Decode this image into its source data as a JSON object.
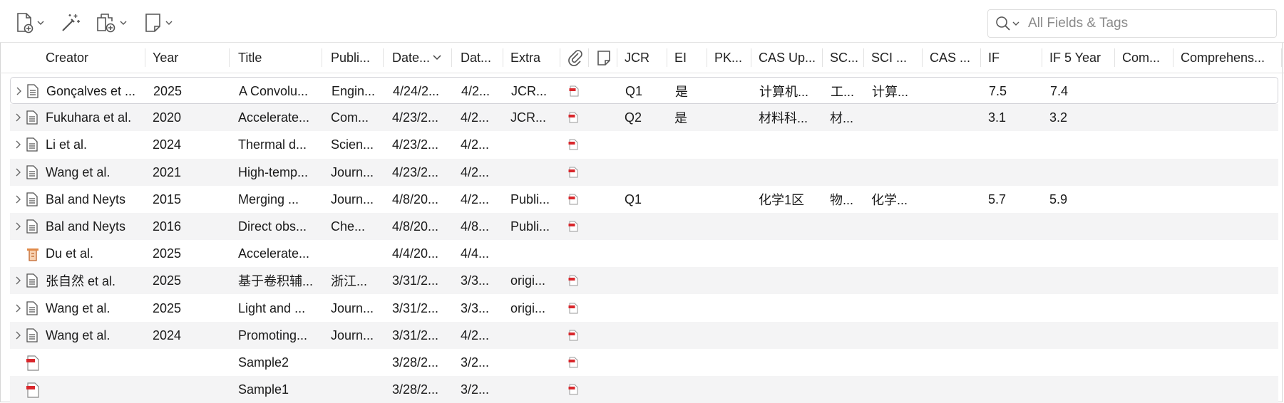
{
  "toolbar": {
    "new_item_icon": "new-item-icon",
    "magic_wand_icon": "add-by-identifier-icon",
    "new_attachment_icon": "new-attachment-icon",
    "new_note_icon": "new-note-icon",
    "search_placeholder": "All Fields & Tags"
  },
  "columns": [
    {
      "key": "creator",
      "label": "Creator"
    },
    {
      "key": "year",
      "label": "Year"
    },
    {
      "key": "title",
      "label": "Title"
    },
    {
      "key": "publication",
      "label": "Publi..."
    },
    {
      "key": "date_added",
      "label": "Date..."
    },
    {
      "key": "date_modified",
      "label": "Dat..."
    },
    {
      "key": "extra",
      "label": "Extra"
    },
    {
      "key": "attachments",
      "label": ""
    },
    {
      "key": "notes",
      "label": ""
    },
    {
      "key": "jcr",
      "label": "JCR"
    },
    {
      "key": "ei",
      "label": "EI"
    },
    {
      "key": "pku",
      "label": "PK..."
    },
    {
      "key": "cas_up",
      "label": "CAS Up..."
    },
    {
      "key": "sc",
      "label": "SC..."
    },
    {
      "key": "sci",
      "label": "SCI ..."
    },
    {
      "key": "cas",
      "label": "CAS ..."
    },
    {
      "key": "if",
      "label": "IF"
    },
    {
      "key": "if5",
      "label": "IF 5 Year"
    },
    {
      "key": "com",
      "label": "Com..."
    },
    {
      "key": "comprehensive",
      "label": "Comprehens..."
    }
  ],
  "rows": [
    {
      "expandable": true,
      "type": "journal",
      "creator": "Gonçalves et ...",
      "year": "2025",
      "title": "A Convolu...",
      "publication": "Engin...",
      "date_added": "4/24/2...",
      "date_modified": "4/2...",
      "extra": "JCR...",
      "pdf": true,
      "jcr": "Q1",
      "ei": "是",
      "pku": "",
      "cas_up": "计算机...",
      "sc": "工...",
      "sci": "计算...",
      "cas": "",
      "if": "7.5",
      "if5": "7.4"
    },
    {
      "expandable": true,
      "type": "journal",
      "creator": "Fukuhara et al.",
      "year": "2020",
      "title": "Accelerate...",
      "publication": "Com...",
      "date_added": "4/23/2...",
      "date_modified": "4/2...",
      "extra": "JCR...",
      "pdf": true,
      "jcr": "Q2",
      "ei": "是",
      "pku": "",
      "cas_up": "材料科...",
      "sc": "材...",
      "sci": "",
      "cas": "",
      "if": "3.1",
      "if5": "3.2"
    },
    {
      "expandable": true,
      "type": "journal",
      "creator": "Li et al.",
      "year": "2024",
      "title": "Thermal d...",
      "publication": "Scien...",
      "date_added": "4/23/2...",
      "date_modified": "4/2...",
      "extra": "",
      "pdf": true,
      "jcr": "",
      "ei": "",
      "pku": "",
      "cas_up": "",
      "sc": "",
      "sci": "",
      "cas": "",
      "if": "",
      "if5": ""
    },
    {
      "expandable": true,
      "type": "journal",
      "creator": "Wang et al.",
      "year": "2021",
      "title": "High-temp...",
      "publication": "Journ...",
      "date_added": "4/23/2...",
      "date_modified": "4/2...",
      "extra": "",
      "pdf": true,
      "jcr": "",
      "ei": "",
      "pku": "",
      "cas_up": "",
      "sc": "",
      "sci": "",
      "cas": "",
      "if": "",
      "if5": ""
    },
    {
      "expandable": true,
      "type": "journal",
      "creator": "Bal and Neyts",
      "year": "2015",
      "title": "Merging ...",
      "publication": "Journ...",
      "date_added": "4/8/20...",
      "date_modified": "4/2...",
      "extra": "Publi...",
      "pdf": true,
      "jcr": "Q1",
      "ei": "",
      "pku": "",
      "cas_up": "化学1区",
      "sc": "物...",
      "sci": "化学...",
      "cas": "",
      "if": "5.7",
      "if5": "5.9"
    },
    {
      "expandable": true,
      "type": "journal",
      "creator": "Bal and Neyts",
      "year": "2016",
      "title": "Direct obs...",
      "publication": "Che...",
      "date_added": "4/8/20...",
      "date_modified": "4/8...",
      "extra": "Publi...",
      "pdf": true,
      "jcr": "",
      "ei": "",
      "pku": "",
      "cas_up": "",
      "sc": "",
      "sci": "",
      "cas": "",
      "if": "",
      "if5": ""
    },
    {
      "expandable": false,
      "type": "preprint",
      "creator": "Du et al.",
      "year": "2025",
      "title": "Accelerate...",
      "publication": "",
      "date_added": "4/4/20...",
      "date_modified": "4/4...",
      "extra": "",
      "pdf": false,
      "jcr": "",
      "ei": "",
      "pku": "",
      "cas_up": "",
      "sc": "",
      "sci": "",
      "cas": "",
      "if": "",
      "if5": ""
    },
    {
      "expandable": true,
      "type": "journal",
      "creator": "张自然 et al.",
      "year": "2025",
      "title": "基于卷积辅...",
      "publication": "浙江...",
      "date_added": "3/31/2...",
      "date_modified": "3/3...",
      "extra": "origi...",
      "pdf": true,
      "jcr": "",
      "ei": "",
      "pku": "",
      "cas_up": "",
      "sc": "",
      "sci": "",
      "cas": "",
      "if": "",
      "if5": ""
    },
    {
      "expandable": true,
      "type": "journal",
      "creator": "Wang et al.",
      "year": "2025",
      "title": "Light and ...",
      "publication": "Journ...",
      "date_added": "3/31/2...",
      "date_modified": "3/3...",
      "extra": "origi...",
      "pdf": true,
      "jcr": "",
      "ei": "",
      "pku": "",
      "cas_up": "",
      "sc": "",
      "sci": "",
      "cas": "",
      "if": "",
      "if5": ""
    },
    {
      "expandable": true,
      "type": "journal",
      "creator": "Wang et al.",
      "year": "2024",
      "title": "Promoting...",
      "publication": "Journ...",
      "date_added": "3/31/2...",
      "date_modified": "4/2...",
      "extra": "",
      "pdf": true,
      "jcr": "",
      "ei": "",
      "pku": "",
      "cas_up": "",
      "sc": "",
      "sci": "",
      "cas": "",
      "if": "",
      "if5": ""
    },
    {
      "expandable": false,
      "type": "pdf",
      "creator": "",
      "year": "",
      "title": "Sample2",
      "publication": "",
      "date_added": "3/28/2...",
      "date_modified": "3/2...",
      "extra": "",
      "pdf": true,
      "jcr": "",
      "ei": "",
      "pku": "",
      "cas_up": "",
      "sc": "",
      "sci": "",
      "cas": "",
      "if": "",
      "if5": ""
    },
    {
      "expandable": false,
      "type": "pdf",
      "creator": "",
      "year": "",
      "title": "Sample1",
      "publication": "",
      "date_added": "3/28/2...",
      "date_modified": "3/2...",
      "extra": "",
      "pdf": true,
      "jcr": "",
      "ei": "",
      "pku": "",
      "cas_up": "",
      "sc": "",
      "sci": "",
      "cas": "",
      "if": "",
      "if5": ""
    }
  ],
  "colors": {
    "selected_border": "#d3d3d8",
    "alt_row": "#f4f4f5",
    "pdf_red": "#d9262b"
  }
}
